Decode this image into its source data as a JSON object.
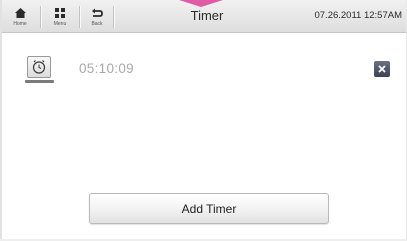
{
  "navigation": {
    "home_label": "Home",
    "menu_label": "Menu",
    "back_label": "Back"
  },
  "header": {
    "title": "Timer",
    "datetime": "07.26.2011 12:57AM"
  },
  "timers": [
    {
      "value": "05:10:09"
    }
  ],
  "actions": {
    "add_timer_label": "Add Timer"
  },
  "icons": {
    "home": "home-icon",
    "menu": "menu-grid-icon",
    "back": "back-arrow-icon",
    "alarm": "alarm-clock-icon",
    "close": "close-icon"
  },
  "colors": {
    "pointer_accent": "#e05aa6",
    "close_button": "#4a5060",
    "timer_text": "#a8a8a8"
  }
}
